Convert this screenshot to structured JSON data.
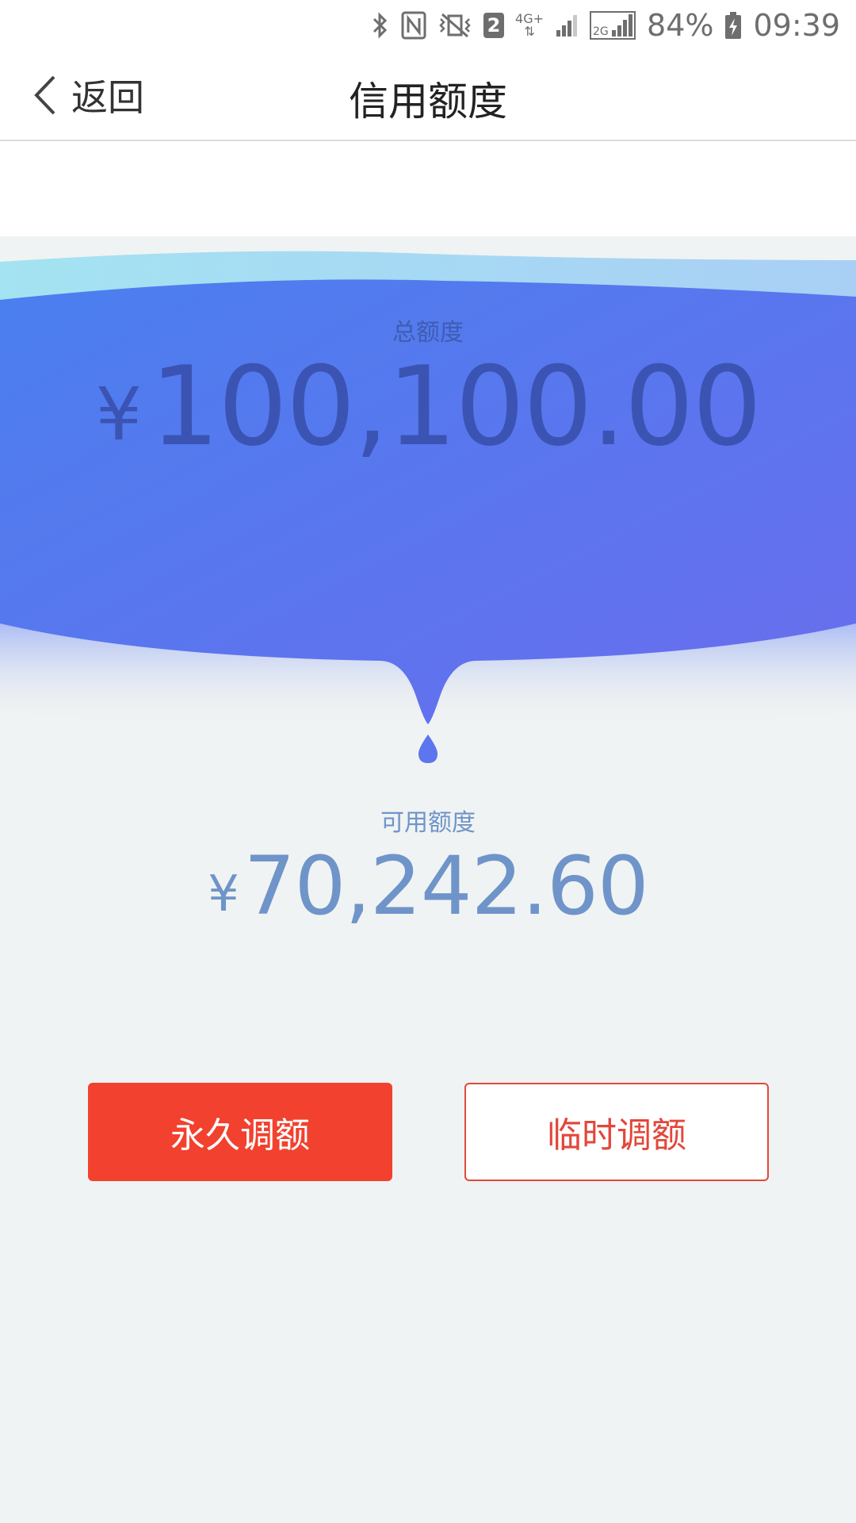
{
  "status_bar": {
    "battery_percent": "84%",
    "time": "09:39",
    "sim_slot": "2",
    "network_4g": "4G+",
    "network_2g": "2G",
    "icons": [
      "bluetooth-icon",
      "nfc-icon",
      "vibrate-icon",
      "sim-icon",
      "signal-icon",
      "battery-icon"
    ]
  },
  "nav": {
    "back_label": "返回",
    "title": "信用额度"
  },
  "total": {
    "label": "总额度",
    "currency": "¥",
    "amount": "100,100.00"
  },
  "available": {
    "label": "可用额度",
    "currency": "¥",
    "amount": "70,242.60"
  },
  "actions": {
    "permanent_label": "永久调额",
    "temporary_label": "临时调额"
  },
  "colors": {
    "primary_red": "#f2412e",
    "blob_blue_start": "#4a7fef",
    "blob_blue_end": "#6a6ded",
    "amount_text_dark": "#3b54b3",
    "amount_text_light": "#6f94c9"
  }
}
